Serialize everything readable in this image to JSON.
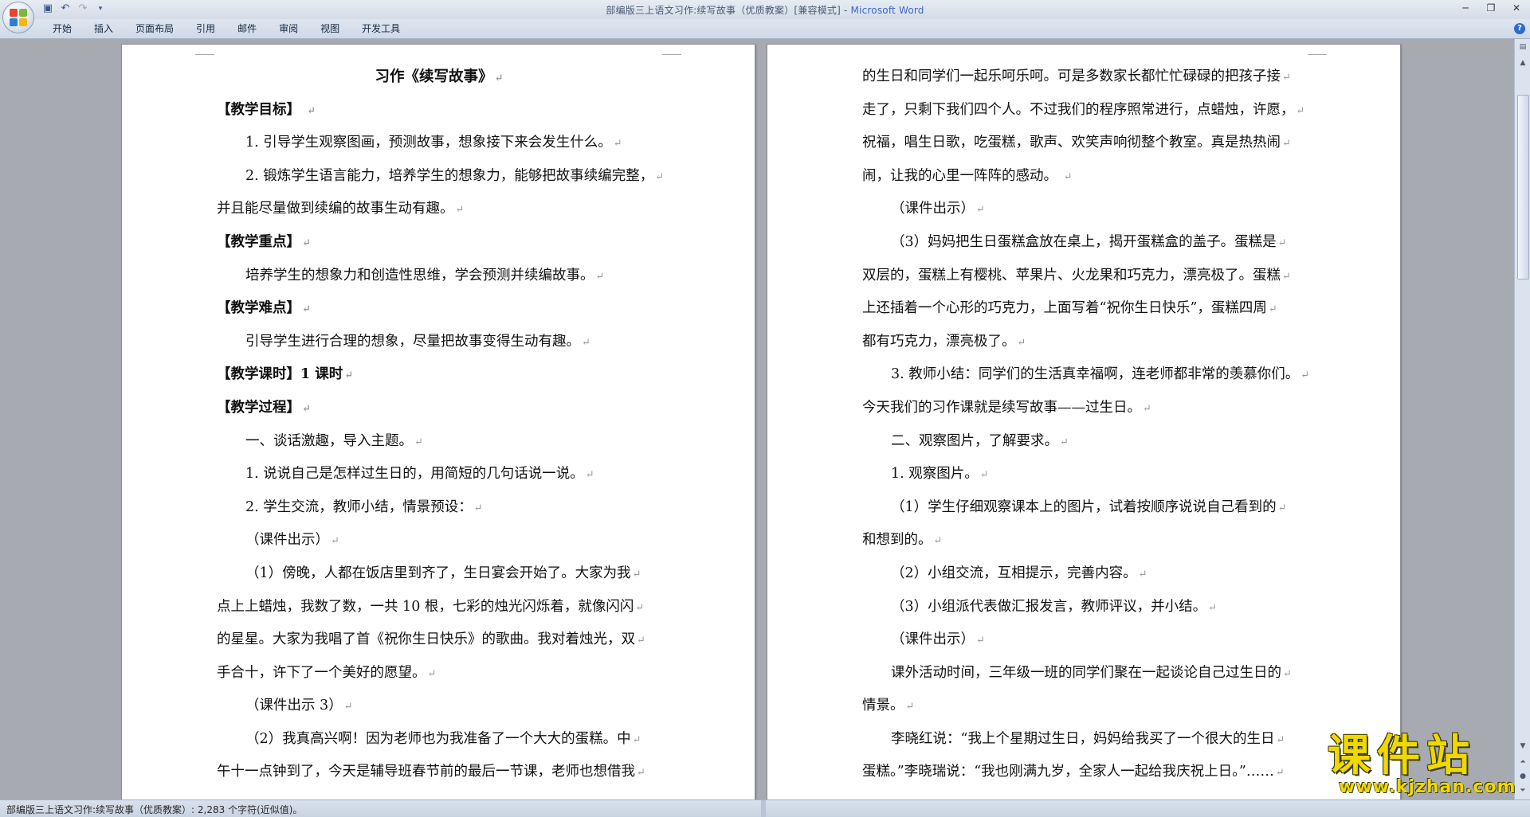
{
  "window": {
    "title": "部编版三上语文习作:续写故事（优质教案）[兼容模式] - ",
    "app_name": "Microsoft Word"
  },
  "ribbon": {
    "tabs": [
      "开始",
      "插入",
      "页面布局",
      "引用",
      "邮件",
      "审阅",
      "视图",
      "开发工具"
    ]
  },
  "pages": {
    "left": {
      "lines": [
        {
          "text": "习作《续写故事》",
          "style": "title"
        },
        {
          "text": "【教学目标】   ",
          "style": "bold"
        },
        {
          "text": "1. 引导学生观察图画，预测故事，想象接下来会发生什么。",
          "style": "indent"
        },
        {
          "text": "2. 锻炼学生语言能力，培养学生的想象力，能够把故事续编完整，",
          "style": "indent"
        },
        {
          "text": "并且能尽量做到续编的故事生动有趣。",
          "style": ""
        },
        {
          "text": "【教学重点】",
          "style": "bold"
        },
        {
          "text": "培养学生的想象力和创造性思维，学会预测并续编故事。",
          "style": "indent"
        },
        {
          "text": "【教学难点】",
          "style": "bold"
        },
        {
          "text": "引导学生进行合理的想象，尽量把故事变得生动有趣。",
          "style": "indent"
        },
        {
          "text": "【教学课时】1 课时",
          "style": "bold"
        },
        {
          "text": "【教学过程】",
          "style": "bold"
        },
        {
          "text": "一、谈话激趣，导入主题。",
          "style": "indent"
        },
        {
          "text": "1. 说说自己是怎样过生日的，用简短的几句话说一说。",
          "style": "indent"
        },
        {
          "text": "2. 学生交流，教师小结，情景预设：",
          "style": "indent"
        },
        {
          "text": "（课件出示）",
          "style": "indent"
        },
        {
          "text": "（1）傍晚，人都在饭店里到齐了，生日宴会开始了。大家为我",
          "style": "indent"
        },
        {
          "text": "点上上蜡烛，我数了数，一共 10 根，七彩的烛光闪烁着，就像闪闪",
          "style": ""
        },
        {
          "text": "的星星。大家为我唱了首《祝你生日快乐》的歌曲。我对着烛光，双",
          "style": ""
        },
        {
          "text": "手合十，许下了一个美好的愿望。",
          "style": ""
        },
        {
          "text": "（课件出示 3）",
          "style": "indent"
        },
        {
          "text": "（2）我真高兴啊！因为老师也为我准备了一个大大的蛋糕。中",
          "style": "indent"
        },
        {
          "text": "午十一点钟到了，今天是辅导班春节前的最后一节课，老师也想借我",
          "style": ""
        }
      ]
    },
    "right": {
      "lines": [
        {
          "text": "的生日和同学们一起乐呵乐呵。可是多数家长都忙忙碌碌的把孩子接",
          "style": ""
        },
        {
          "text": "走了，只剩下我们四个人。不过我们的程序照常进行，点蜡烛，许愿，",
          "style": ""
        },
        {
          "text": "祝福，唱生日歌，吃蛋糕，歌声、欢笑声响彻整个教室。真是热热闹",
          "style": ""
        },
        {
          "text": "闹，让我的心里一阵阵的感动。   ",
          "style": ""
        },
        {
          "text": "（课件出示）",
          "style": "indent"
        },
        {
          "text": "（3）妈妈把生日蛋糕盒放在桌上，揭开蛋糕盒的盖子。蛋糕是",
          "style": "indent"
        },
        {
          "text": "双层的，蛋糕上有樱桃、苹果片、火龙果和巧克力，漂亮极了。蛋糕",
          "style": ""
        },
        {
          "text": "上还插着一个心形的巧克力，上面写着“祝你生日快乐”，蛋糕四周",
          "style": ""
        },
        {
          "text": "都有巧克力，漂亮极了。",
          "style": ""
        },
        {
          "text": "3. 教师小结：同学们的生活真幸福啊，连老师都非常的羡慕你们。",
          "style": "indent"
        },
        {
          "text": "今天我们的习作课就是续写故事——过生日。",
          "style": ""
        },
        {
          "text": "二、观察图片，了解要求。",
          "style": "indent"
        },
        {
          "text": "1. 观察图片。",
          "style": "indent"
        },
        {
          "text": "（1）学生仔细观察课本上的图片，试着按顺序说说自己看到的",
          "style": "indent"
        },
        {
          "text": "和想到的。",
          "style": ""
        },
        {
          "text": "（2）小组交流，互相提示，完善内容。",
          "style": "indent"
        },
        {
          "text": "（3）小组派代表做汇报发言，教师评议，并小结。",
          "style": "indent"
        },
        {
          "text": "（课件出示）",
          "style": "indent"
        },
        {
          "text": "课外活动时间，三年级一班的同学们聚在一起谈论自己过生日的",
          "style": "indent"
        },
        {
          "text": "情景。",
          "style": ""
        },
        {
          "text": "李晓红说：“我上个星期过生日，妈妈给我买了一个很大的生日",
          "style": "indent"
        },
        {
          "text": "蛋糕。”李晓瑞说：“我也刚满九岁，全家人一起给我庆祝上日。”……",
          "style": ""
        }
      ]
    }
  },
  "status": {
    "text": "部编版三上语文习作:续写故事（优质教案）: 2,283 个字符(近似值)。"
  },
  "watermark": {
    "main": "课件站",
    "url": "www.kjzhan.com"
  },
  "icons": {
    "paragraph_mark": "↵"
  }
}
